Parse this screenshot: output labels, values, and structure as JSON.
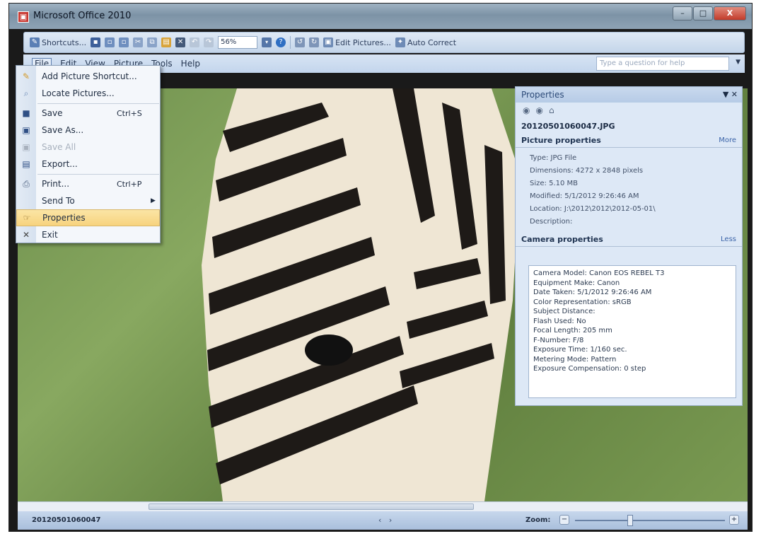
{
  "window": {
    "title": "Microsoft Office 2010",
    "minimize": "–",
    "maximize": "□",
    "close": "X"
  },
  "toolbar": {
    "shortcuts": "Shortcuts...",
    "zoom_value": "56%",
    "edit_pictures": "Edit Pictures...",
    "auto_correct": "Auto Correct"
  },
  "menubar": {
    "items": [
      "File",
      "Edit",
      "View",
      "Picture",
      "Tools",
      "Help"
    ],
    "help_placeholder": "Type a question for help"
  },
  "file_menu": {
    "items": [
      {
        "label": "Add Picture Shortcut...",
        "shortcut": ""
      },
      {
        "label": "Locate Pictures...",
        "shortcut": ""
      },
      {
        "label": "Save",
        "shortcut": "Ctrl+S"
      },
      {
        "label": "Save As...",
        "shortcut": ""
      },
      {
        "label": "Save All",
        "shortcut": ""
      },
      {
        "label": "Export...",
        "shortcut": ""
      },
      {
        "label": "Print...",
        "shortcut": "Ctrl+P"
      },
      {
        "label": "Send To",
        "shortcut": ""
      },
      {
        "label": "Properties",
        "shortcut": ""
      },
      {
        "label": "Exit",
        "shortcut": ""
      }
    ]
  },
  "properties": {
    "title": "Properties",
    "filename": "20120501060047.JPG",
    "picture_section": "Picture properties",
    "picture_link": "More",
    "picture_props": [
      "Type: JPG File",
      "Dimensions: 4272 x 2848 pixels",
      "Size: 5.10 MB",
      "Modified: 5/1/2012 9:26:46 AM",
      "Location: J:\\2012\\2012\\2012-05-01\\",
      "Description:"
    ],
    "camera_section": "Camera properties",
    "camera_link": "Less",
    "camera_props": [
      "Camera Model: Canon EOS REBEL T3",
      "Equipment Make: Canon",
      "Date Taken: 5/1/2012 9:26:46 AM",
      "Color Representation: sRGB",
      "Subject Distance:",
      "Flash Used: No",
      "Focal Length: 205 mm",
      "F-Number: F/8",
      "Exposure Time: 1/160 sec.",
      "Metering Mode: Pattern",
      "Exposure Compensation: 0 step"
    ]
  },
  "status": {
    "filename": "20120501060047",
    "zoom_label": "Zoom:",
    "zoom_level": 0.37
  }
}
